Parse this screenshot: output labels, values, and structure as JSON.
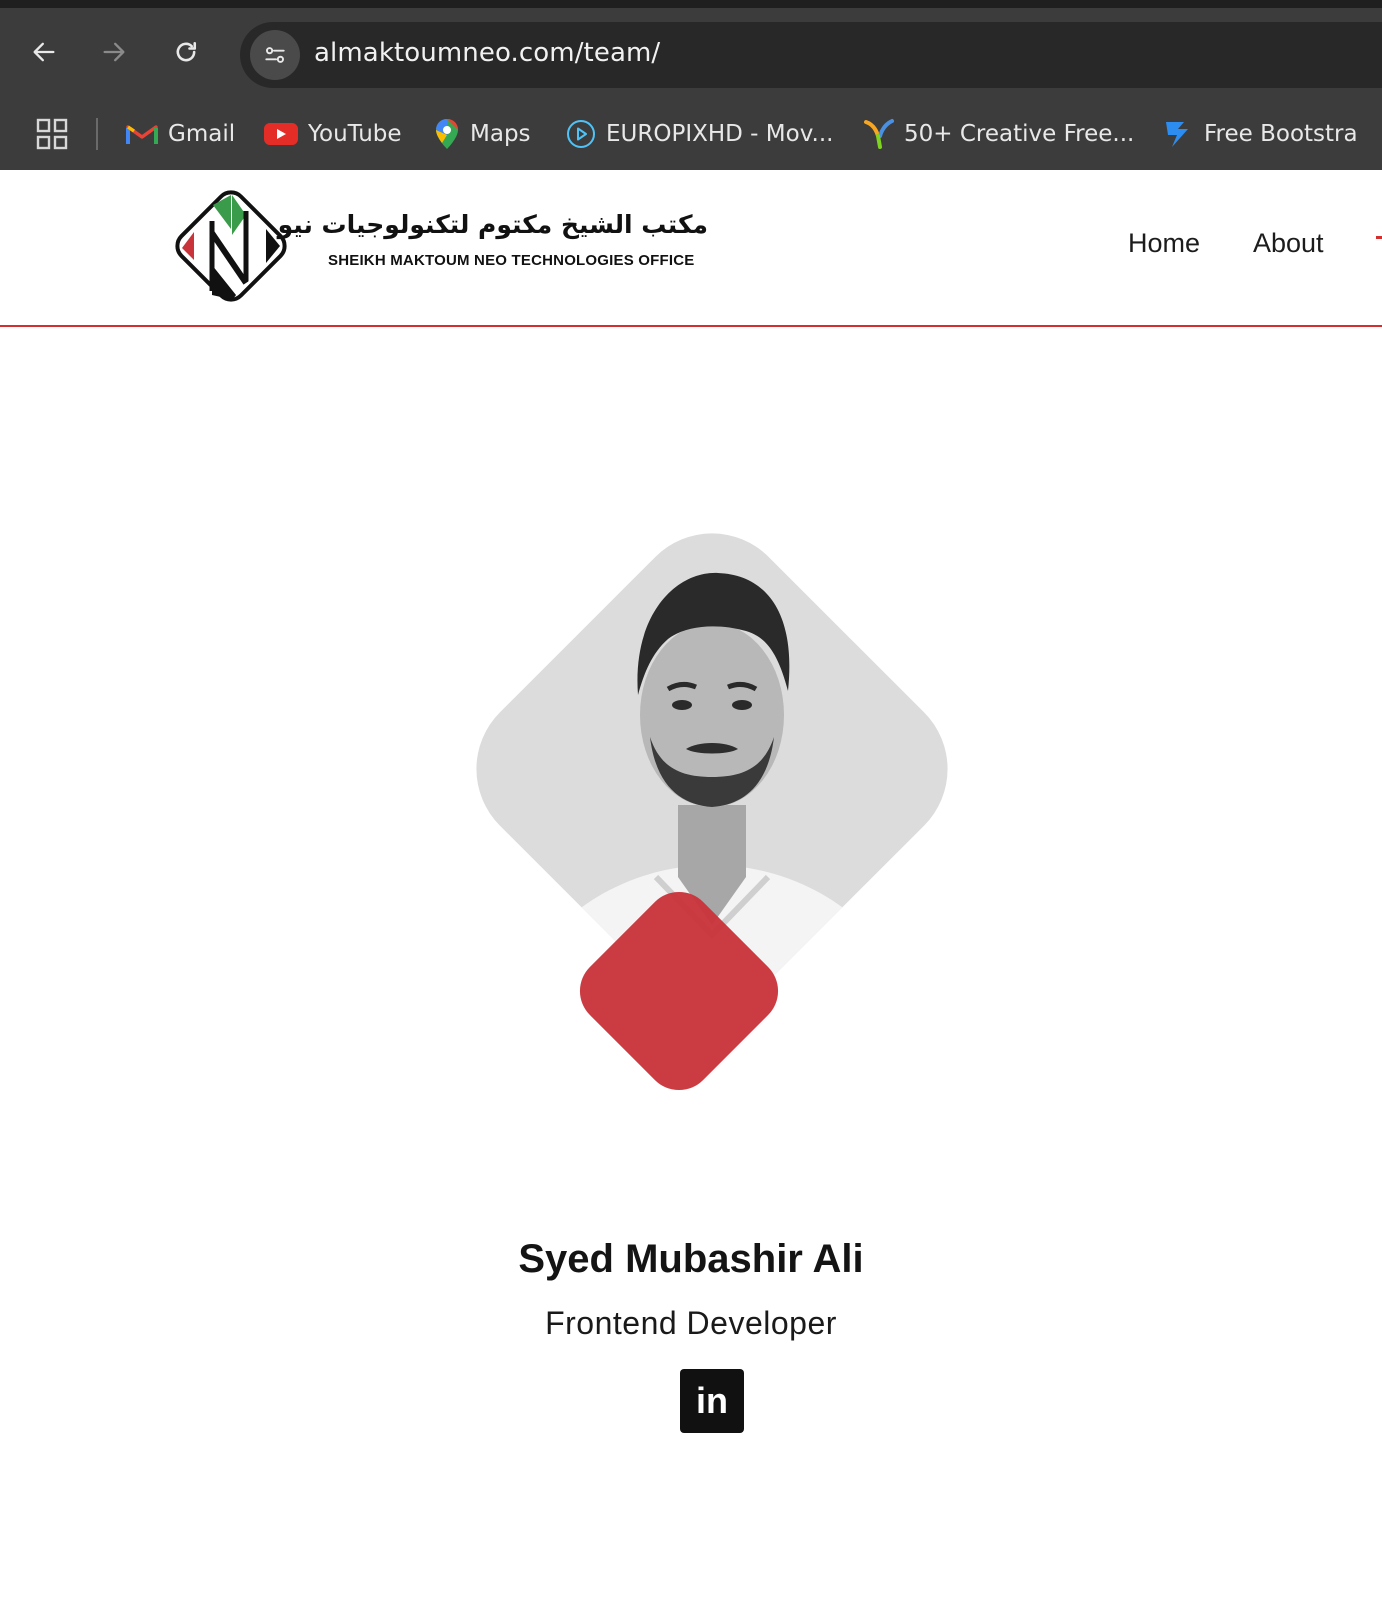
{
  "browser": {
    "url": "almaktoumneo.com/team/",
    "bookmarks": [
      {
        "label": "Gmail",
        "icon": "gmail-icon"
      },
      {
        "label": "YouTube",
        "icon": "youtube-icon"
      },
      {
        "label": "Maps",
        "icon": "maps-icon"
      },
      {
        "label": "EUROPIXHD - Mov...",
        "icon": "play-circle-icon"
      },
      {
        "label": "50+ Creative Free...",
        "icon": "bird-icon"
      },
      {
        "label": "Free Bootstra",
        "icon": "bootstrap-icon"
      }
    ]
  },
  "header": {
    "logo_arabic": "مكتب الشيخ مكتوم لتكنولوجيات نيو",
    "logo_english": "SHEIKH MAKTOUM NEO TECHNOLOGIES OFFICE",
    "nav": [
      {
        "label": "Home"
      },
      {
        "label": "About"
      }
    ]
  },
  "member": {
    "name": "Syed Mubashir Ali",
    "role": "Frontend Developer",
    "social_label": "in"
  },
  "colors": {
    "accent_red": "#c9343a",
    "chrome_bg": "#3c3c3c",
    "urlbar_bg": "#282828",
    "linkedin_bg": "#111111"
  }
}
